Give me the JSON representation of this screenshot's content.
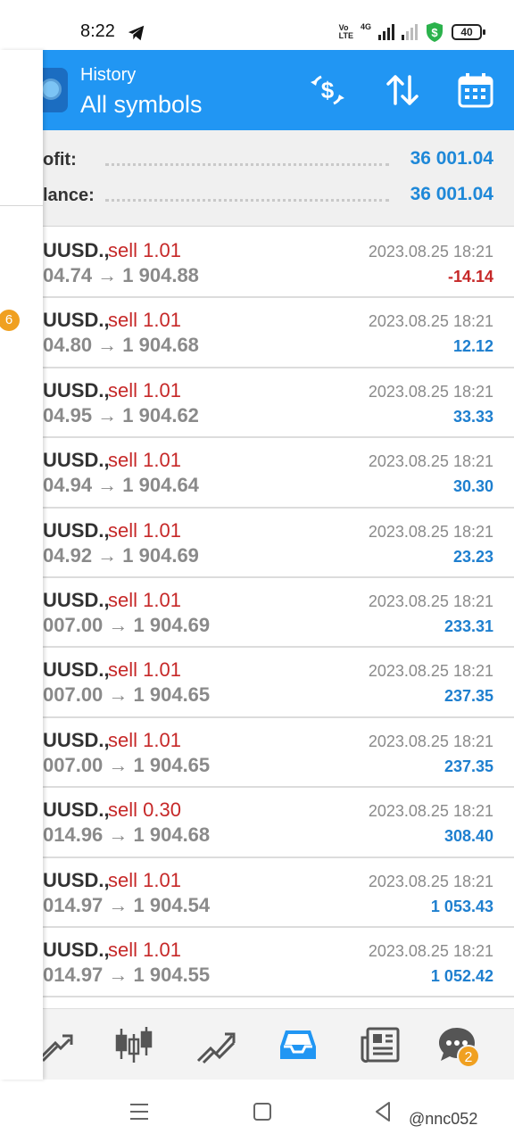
{
  "status_bar": {
    "time": "8:22",
    "volte": "Vo\nLTE",
    "network": "4G",
    "battery": "40",
    "icons": [
      "telegram-icon",
      "signal-icon",
      "shield-dollar-icon",
      "battery-icon"
    ]
  },
  "drawer": {
    "badge": "6"
  },
  "header": {
    "subtitle": "History",
    "title": "All symbols",
    "actions": [
      "deposit-icon",
      "sort-icon",
      "calendar-icon"
    ],
    "brand_color": "#2196f3"
  },
  "summary": {
    "profit_label": "ofit:",
    "profit_value": "36 001.04",
    "balance_label": "lance:",
    "balance_value": "36 001.04"
  },
  "trades": [
    {
      "symbol": "UUSD.,",
      "side": "sell 1.01",
      "prices": "04.74 → 1 904.88",
      "date": "2023.08.25 18:21",
      "profit": "-14.14",
      "negative": true
    },
    {
      "symbol": "UUSD.,",
      "side": "sell 1.01",
      "prices": "04.80 → 1 904.68",
      "date": "2023.08.25 18:21",
      "profit": "12.12",
      "negative": false
    },
    {
      "symbol": "UUSD.,",
      "side": "sell 1.01",
      "prices": "04.95 → 1 904.62",
      "date": "2023.08.25 18:21",
      "profit": "33.33",
      "negative": false
    },
    {
      "symbol": "UUSD.,",
      "side": "sell 1.01",
      "prices": "04.94 → 1 904.64",
      "date": "2023.08.25 18:21",
      "profit": "30.30",
      "negative": false
    },
    {
      "symbol": "UUSD.,",
      "side": "sell 1.01",
      "prices": "04.92 → 1 904.69",
      "date": "2023.08.25 18:21",
      "profit": "23.23",
      "negative": false
    },
    {
      "symbol": "UUSD.,",
      "side": "sell 1.01",
      "prices": "007.00 → 1 904.69",
      "date": "2023.08.25 18:21",
      "profit": "233.31",
      "negative": false
    },
    {
      "symbol": "UUSD.,",
      "side": "sell 1.01",
      "prices": "007.00 → 1 904.65",
      "date": "2023.08.25 18:21",
      "profit": "237.35",
      "negative": false
    },
    {
      "symbol": "UUSD.,",
      "side": "sell 1.01",
      "prices": "007.00 → 1 904.65",
      "date": "2023.08.25 18:21",
      "profit": "237.35",
      "negative": false
    },
    {
      "symbol": "UUSD.,",
      "side": "sell 0.30",
      "prices": "014.96 → 1 904.68",
      "date": "2023.08.25 18:21",
      "profit": "308.40",
      "negative": false
    },
    {
      "symbol": "UUSD.,",
      "side": "sell 1.01",
      "prices": "014.97 → 1 904.54",
      "date": "2023.08.25 18:21",
      "profit": "1 053.43",
      "negative": false
    },
    {
      "symbol": "UUSD.,",
      "side": "sell 1.01",
      "prices": "014.97 → 1 904.55",
      "date": "2023.08.25 18:21",
      "profit": "1 052.42",
      "negative": false
    }
  ],
  "tab_bar": {
    "tabs": [
      "trade-icon",
      "candlestick-chart-icon",
      "chart-trend-icon",
      "history-inbox-icon",
      "news-icon",
      "chat-icon"
    ],
    "active_tab": "history-inbox-icon",
    "chat_badge": "2",
    "active_color": "#2196f3"
  },
  "system_nav": {
    "watermark": "@nnc052",
    "buttons": [
      "menu-icon",
      "home-icon",
      "back-icon"
    ]
  }
}
